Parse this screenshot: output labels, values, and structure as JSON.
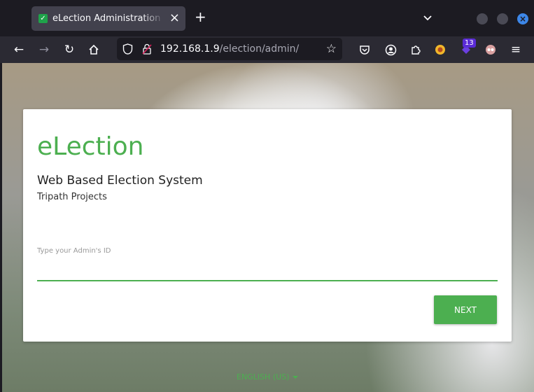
{
  "tab": {
    "title": "eLection Administration Login"
  },
  "url": {
    "host": "192.168.1.9",
    "path": "/election/admin/"
  },
  "extensions": {
    "badge_count": "13"
  },
  "card": {
    "brand": "eLection",
    "subtitle": "Web Based Election System",
    "org": "Tripath Projects",
    "field_label": "Type your Admin's ID",
    "field_value": "",
    "next_label": "NEXT"
  },
  "language": {
    "label": "ENGLISH (US)"
  },
  "colors": {
    "accent": "#4caf50",
    "tab_bg": "#42414d",
    "chrome_bg": "#2b2a33"
  }
}
